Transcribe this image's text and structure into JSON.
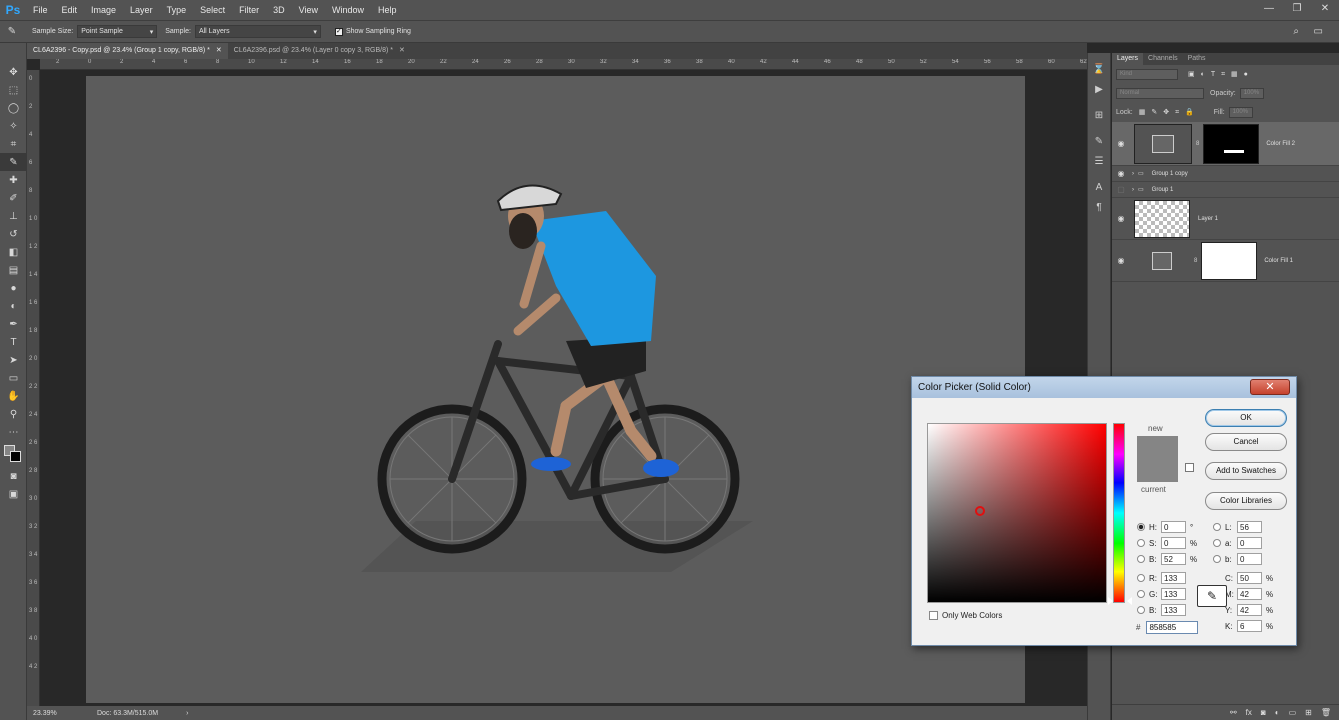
{
  "app": {
    "logo": "Ps"
  },
  "menu": [
    "File",
    "Edit",
    "Image",
    "Layer",
    "Type",
    "Select",
    "Filter",
    "3D",
    "View",
    "Window",
    "Help"
  ],
  "options": {
    "sample_size_label": "Sample Size:",
    "sample_size_value": "Point Sample",
    "sample_label": "Sample:",
    "sample_value": "All Layers",
    "show_ring_label": "Show Sampling Ring",
    "show_ring_checked": true
  },
  "tabs": [
    {
      "label": "CL6A2396 - Copy.psd @ 23.4% (Group 1 copy, RGB/8) *",
      "active": true
    },
    {
      "label": "CL6A2396.psd @ 23.4% (Layer 0 copy 3, RGB/8) *",
      "active": false
    }
  ],
  "ruler": {
    "top": [
      "2",
      "0",
      "2",
      "4",
      "6",
      "8",
      "10",
      "12",
      "14",
      "16",
      "18",
      "20",
      "22",
      "24",
      "26",
      "28",
      "30",
      "32",
      "34",
      "36",
      "38",
      "40",
      "42",
      "44",
      "46",
      "48",
      "50",
      "52",
      "54",
      "56",
      "58",
      "60",
      "62"
    ],
    "left": [
      "0",
      "2",
      "4",
      "6",
      "8",
      "1 0",
      "1 2",
      "1 4",
      "1 6",
      "1 8",
      "2 0",
      "2 2",
      "2 4",
      "2 6",
      "2 8",
      "3 0",
      "3 2",
      "3 4",
      "3 6",
      "3 8",
      "4 0",
      "4 2"
    ]
  },
  "status": {
    "zoom": "23.39%",
    "doc": "Doc: 63.3M/515.0M"
  },
  "layers_panel": {
    "tabs": [
      "Layers",
      "Channels",
      "Paths"
    ],
    "filter_placeholder": "Kind",
    "blend_mode": "Normal",
    "opacity_label": "Opacity:",
    "opacity_value": "100%",
    "lock_label": "Lock:",
    "fill_label": "Fill:",
    "fill_value": "100%",
    "layers": [
      {
        "name": "Color Fill 2",
        "visible": true,
        "selected": true
      },
      {
        "name": "Group 1 copy",
        "visible": true,
        "selected": false
      },
      {
        "name": "Group 1",
        "visible": false,
        "selected": false
      },
      {
        "name": "Layer 1",
        "visible": true,
        "selected": false
      },
      {
        "name": "Color Fill 1",
        "visible": true,
        "selected": false
      }
    ]
  },
  "color_picker": {
    "title": "Color Picker (Solid Color)",
    "close": "✕",
    "new_label": "new",
    "current_label": "current",
    "buttons": {
      "ok": "OK",
      "cancel": "Cancel",
      "add_swatches": "Add to Swatches",
      "libraries": "Color Libraries"
    },
    "fields": {
      "H": {
        "value": "0",
        "unit": "°"
      },
      "S": {
        "value": "0",
        "unit": "%"
      },
      "B": {
        "value": "52",
        "unit": "%"
      },
      "R": {
        "value": "133",
        "unit": ""
      },
      "G": {
        "value": "133",
        "unit": ""
      },
      "Bl": {
        "value": "133",
        "unit": ""
      },
      "L": {
        "value": "56",
        "unit": ""
      },
      "a": {
        "value": "0",
        "unit": ""
      },
      "b": {
        "value": "0",
        "unit": ""
      },
      "C": {
        "value": "50",
        "unit": "%"
      },
      "M": {
        "value": "42",
        "unit": "%"
      },
      "Y": {
        "value": "42",
        "unit": "%"
      },
      "K": {
        "value": "6",
        "unit": "%"
      }
    },
    "labels": {
      "H": "H:",
      "S": "S:",
      "B": "B:",
      "R": "R:",
      "G": "G:",
      "Bl": "B:",
      "L": "L:",
      "a": "a:",
      "b": "b:",
      "C": "C:",
      "M": "M:",
      "Y": "Y:",
      "K": "K:"
    },
    "hex_label": "#",
    "hex": "858585",
    "only_web_colors": "Only Web Colors",
    "new_color": "#858585",
    "current_color": "#858585"
  },
  "canvas": {
    "background": "#5c5c5c"
  }
}
